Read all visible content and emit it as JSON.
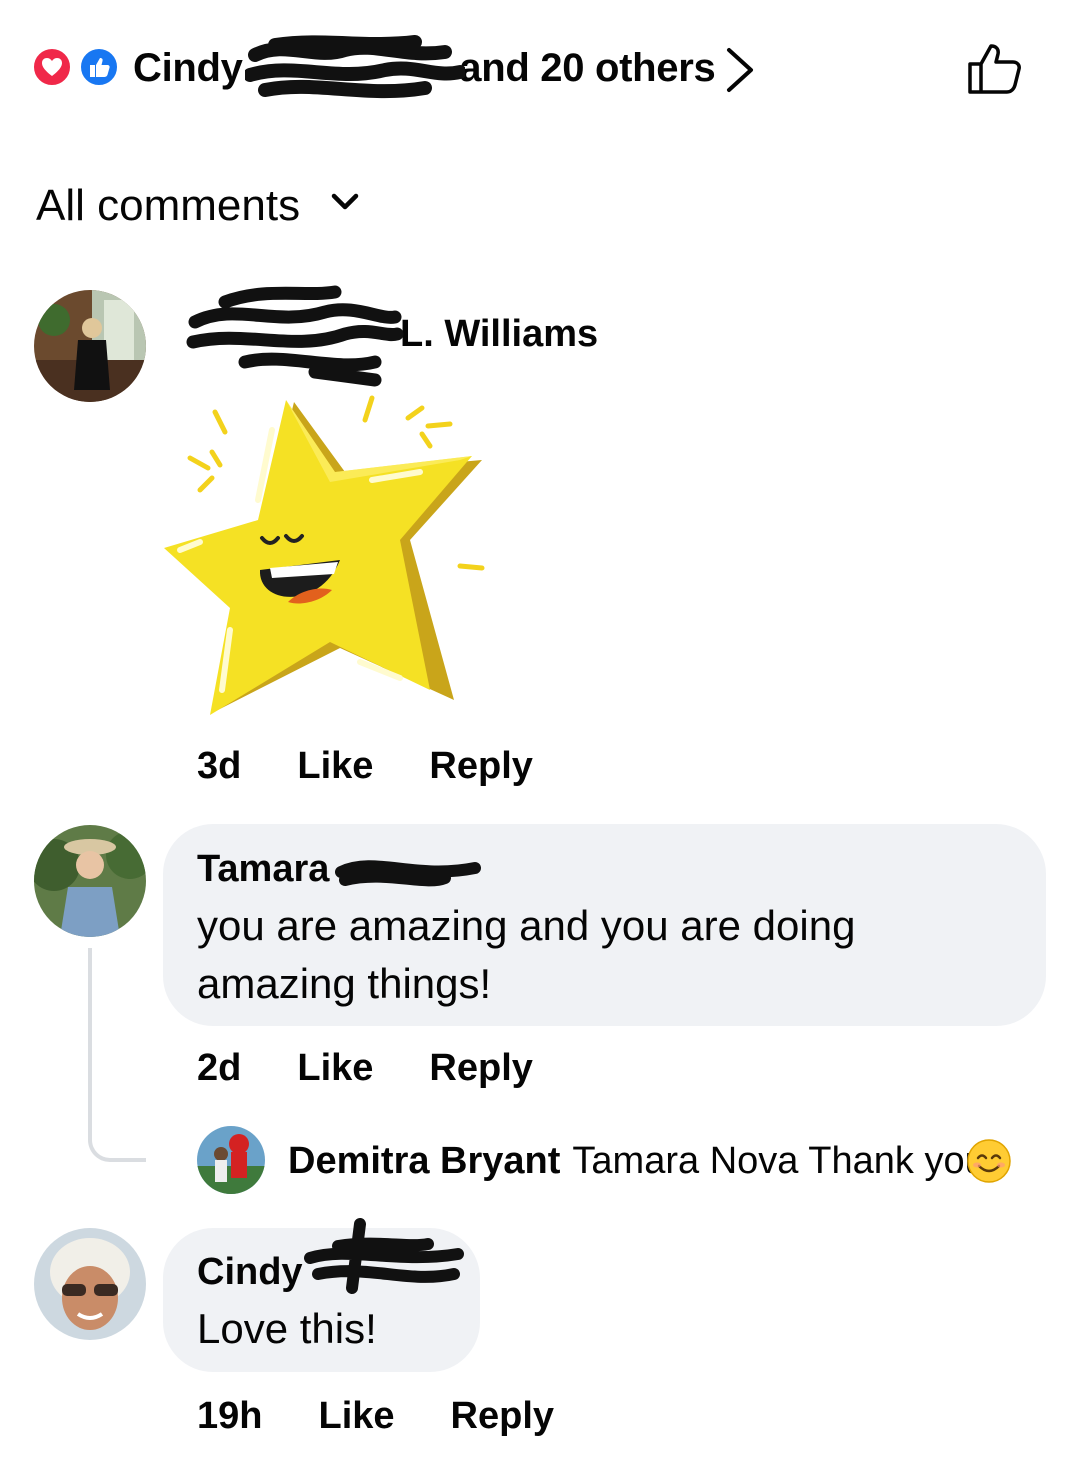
{
  "reactions": {
    "summary_prefix": "Cindy",
    "summary_suffix": "and 20 others",
    "icons": [
      "heart-icon",
      "like-icon"
    ],
    "colors": {
      "love": "#f02849",
      "like": "#1877f2"
    }
  },
  "filter": {
    "label": "All comments"
  },
  "comments": [
    {
      "author": "L. Williams",
      "sticker": "star-sticker",
      "time": "3d",
      "like": "Like",
      "reply": "Reply"
    },
    {
      "author": "Tamara",
      "text": "you are amazing and you are doing amazing things!",
      "time": "2d",
      "like": "Like",
      "reply": "Reply",
      "reply_item": {
        "author": "Demitra Bryant",
        "text": "Tamara Nova Thank you",
        "emoji": "😊"
      }
    },
    {
      "author": "Cindy",
      "text": "Love this!",
      "time": "19h",
      "like": "Like",
      "reply": "Reply"
    }
  ]
}
